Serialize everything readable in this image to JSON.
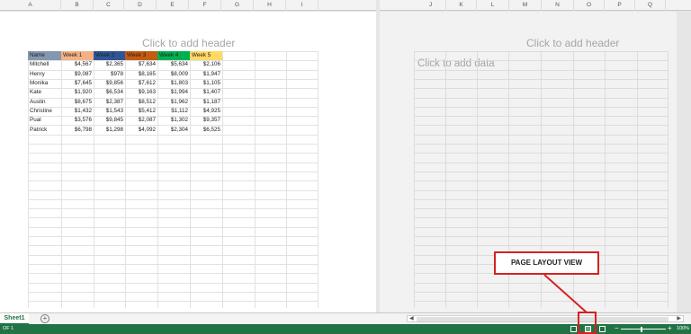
{
  "columns_left": [
    "A",
    "B",
    "C",
    "D",
    "E",
    "F",
    "G",
    "H",
    "I"
  ],
  "columns_right": [
    "J",
    "K",
    "L",
    "M",
    "N",
    "O",
    "P",
    "Q"
  ],
  "page1": {
    "header_placeholder": "Click to add header"
  },
  "page2": {
    "header_placeholder": "Click to add header",
    "data_placeholder": "Click to add data"
  },
  "table": {
    "headers": [
      {
        "label": "Name",
        "color": "#8497b0"
      },
      {
        "label": "Week 1",
        "color": "#f4b183"
      },
      {
        "label": "Week 2",
        "color": "#2f5597"
      },
      {
        "label": "Week 3",
        "color": "#c55a11"
      },
      {
        "label": "Week 4",
        "color": "#00b050"
      },
      {
        "label": "Week 5",
        "color": "#ffd966"
      }
    ],
    "rows": [
      [
        "Mitchell",
        "$4,567",
        "$2,365",
        "$7,634",
        "$5,634",
        "$2,106"
      ],
      [
        "Henry",
        "$9,087",
        "$978",
        "$8,165",
        "$8,009",
        "$1,947"
      ],
      [
        "Monika",
        "$7,645",
        "$9,856",
        "$7,612",
        "$1,803",
        "$1,105"
      ],
      [
        "Kate",
        "$1,920",
        "$6,534",
        "$9,163",
        "$1,994",
        "$1,407"
      ],
      [
        "Austin",
        "$8,675",
        "$2,387",
        "$8,512",
        "$1,962",
        "$1,187"
      ],
      [
        "Christine",
        "$1,432",
        "$1,543",
        "$5,412",
        "$1,112",
        "$4,925"
      ],
      [
        "Pual",
        "$3,576",
        "$9,845",
        "$2,087",
        "$1,302",
        "$9,357"
      ],
      [
        "Patrick",
        "$6,798",
        "$1,298",
        "$4,092",
        "$2,304",
        "$6,525"
      ]
    ]
  },
  "tabs": {
    "sheet_name": "Sheet1",
    "add_sheet_symbol": "+"
  },
  "status_bar": {
    "left_text": "OF 1",
    "zoom_level": "100%",
    "zoom_minus": "−",
    "zoom_plus": "+"
  },
  "annotation": {
    "label": "PAGE LAYOUT VIEW"
  },
  "colors": {
    "accent": "#217346",
    "annotation": "#d6221e"
  }
}
